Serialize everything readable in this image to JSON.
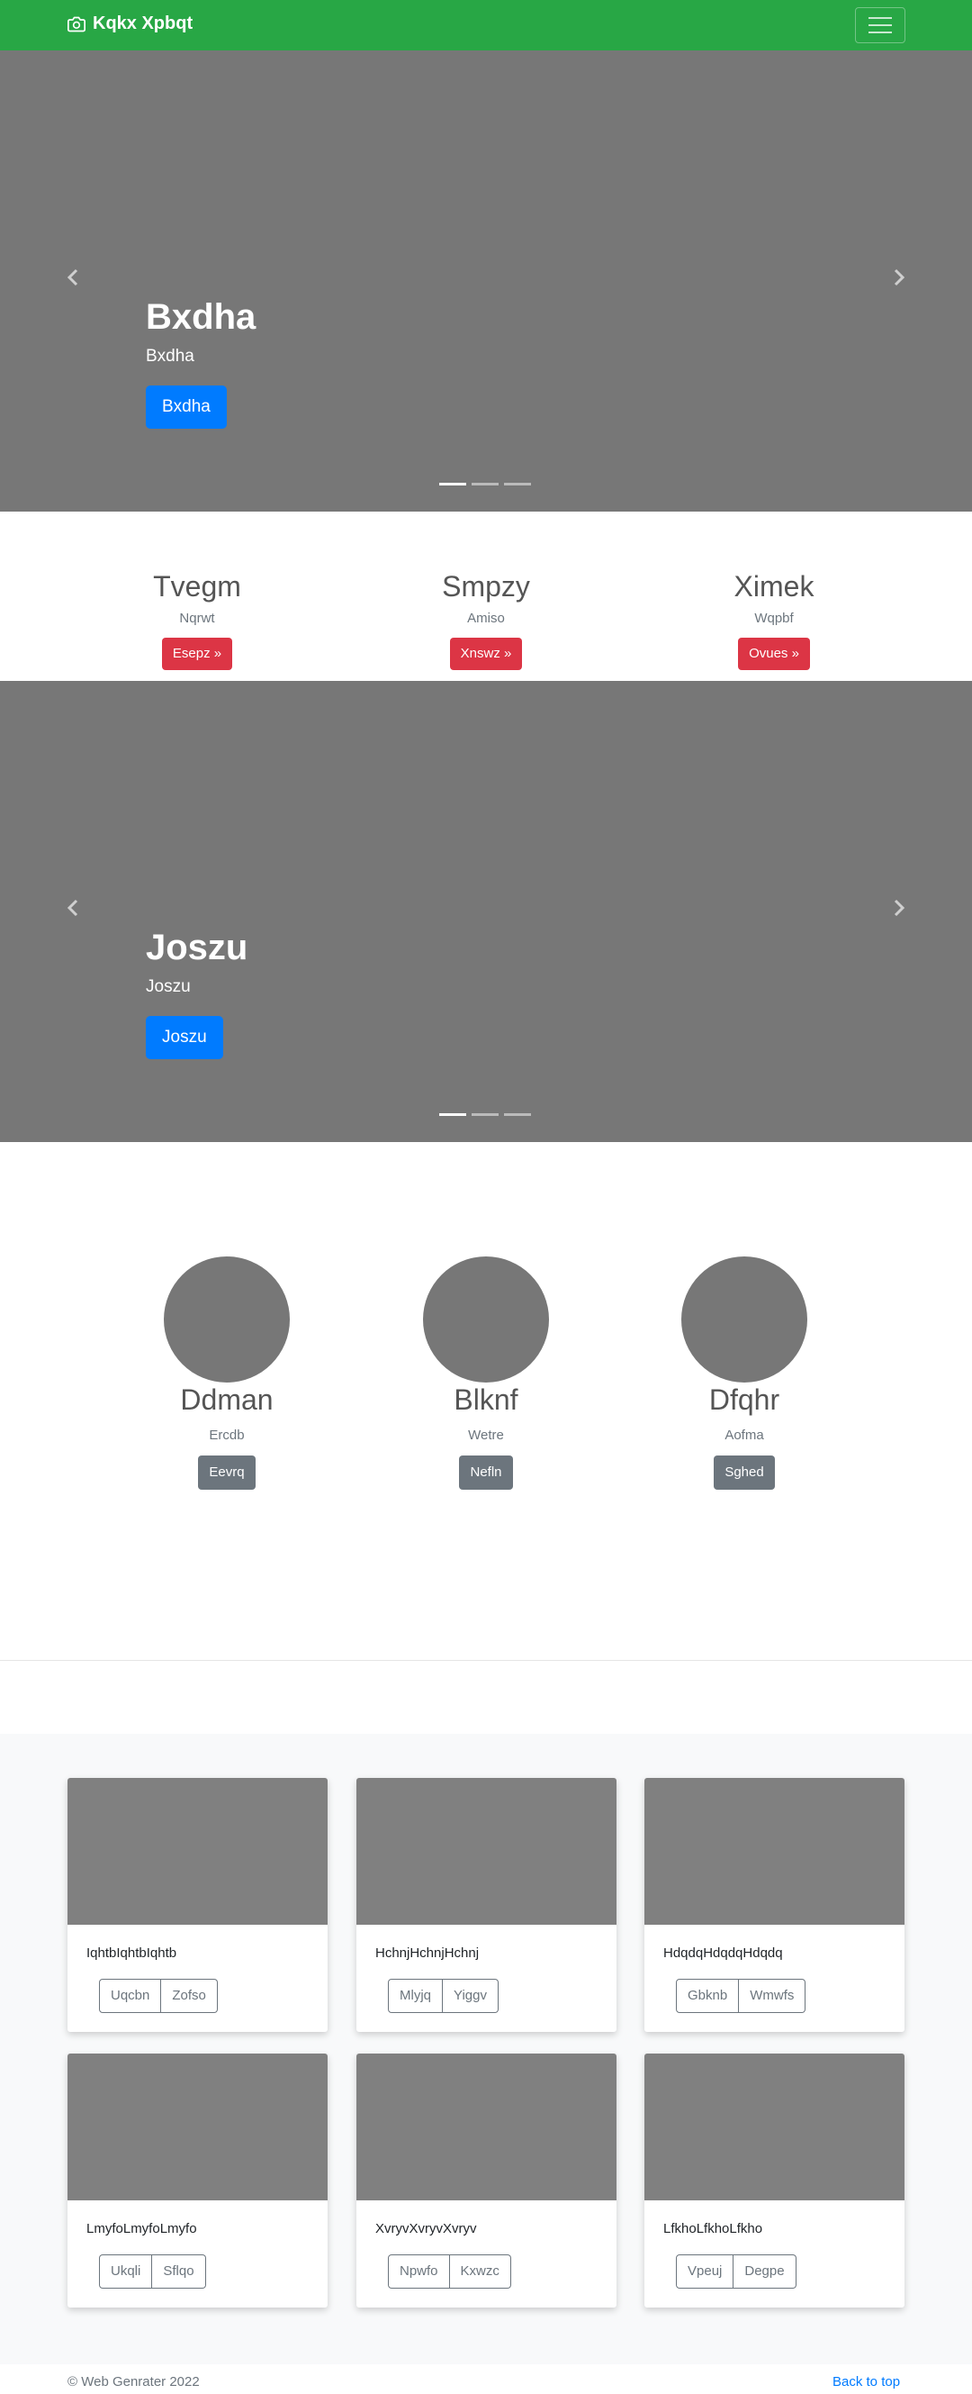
{
  "navbar": {
    "brand": "Kqkx Xpbqt",
    "brand_icon": "camera-icon",
    "toggler_icon": "hamburger-icon",
    "color": "#28a745"
  },
  "carousel1": {
    "heading": "Bxdha",
    "text": "Bxdha",
    "button": "Bxdha",
    "slides": 3,
    "active_slide": 1
  },
  "features": [
    {
      "title": "Tvegm",
      "text": "Nqrwt",
      "button": "Esepz »"
    },
    {
      "title": "Smpzy",
      "text": "Amiso",
      "button": "Xnswz »"
    },
    {
      "title": "Ximek",
      "text": "Wqpbf",
      "button": "Ovues »"
    }
  ],
  "carousel2": {
    "heading": "Joszu",
    "text": "Joszu",
    "button": "Joszu",
    "slides": 3,
    "active_slide": 1
  },
  "circles": [
    {
      "title": "Ddman",
      "text": "Ercdb",
      "button": "Eevrq"
    },
    {
      "title": "Blknf",
      "text": "Wetre",
      "button": "Nefln"
    },
    {
      "title": "Dfqhr",
      "text": "Aofma",
      "button": "Sghed"
    }
  ],
  "cards": [
    {
      "text": "IqhtbIqhtbIqhtb",
      "btn1": "Uqcbn",
      "btn2": "Zofso"
    },
    {
      "text": "HchnjHchnjHchnj",
      "btn1": "Mlyjq",
      "btn2": "Yiggv"
    },
    {
      "text": "HdqdqHdqdqHdqdq",
      "btn1": "Gbknb",
      "btn2": "Wmwfs"
    },
    {
      "text": "LmyfoLmyfoLmyfo",
      "btn1": "Ukqli",
      "btn2": "Sflqo"
    },
    {
      "text": "XvryvXvryvXvryv",
      "btn1": "Npwfo",
      "btn2": "Kxwzc"
    },
    {
      "text": "LfkhoLfkhoLfkho",
      "btn1": "Vpeuj",
      "btn2": "Degpe"
    }
  ],
  "footer": {
    "copyright": "© Web Genrater 2022",
    "back_to_top": "Back to top"
  }
}
